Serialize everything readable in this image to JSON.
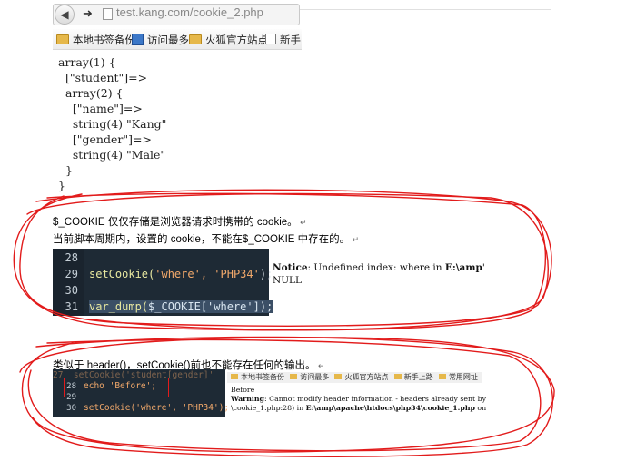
{
  "browser": {
    "url": "test.kang.com/cookie_2.php",
    "back_icon": "arrow-left-icon",
    "forward_icon": "arrow-right-icon",
    "bookmarks": [
      "本地书签备份",
      "访问最多",
      "火狐官方站点",
      "新手"
    ]
  },
  "dump_output": "array(1) {\n  [\"student\"]=>\n  array(2) {\n    [\"name\"]=>\n    string(4) \"Kang\"\n    [\"gender\"]=>\n    string(4) \"Male\"\n  }\n}",
  "section1": {
    "line1": "$_COOKIE 仅仅存储是浏览器请求时携带的 cookie。",
    "line2": "当前脚本周期内，设置的 cookie，不能在$_COOKIE 中存在的。",
    "editor": {
      "lines": [
        {
          "num": "28",
          "code": ""
        },
        {
          "num": "29",
          "fn": "setCookie(",
          "args": "'where', 'PHP34'",
          "end": ");"
        },
        {
          "num": "30",
          "code": ""
        },
        {
          "num": "31",
          "fn": "var_dump(",
          "args": "$_COOKIE['where']",
          "end": ");"
        }
      ]
    },
    "notice": {
      "label": "Notice",
      "message": ": Undefined index: where in ",
      "path": "E:\\amp",
      "tail": "'",
      "null_text": "NULL"
    }
  },
  "section2": {
    "line_prefix": "类似于 header()，",
    "line_underlined": "setCookie()",
    "line_suffix": "前也不能存在任何的输出。",
    "editor": {
      "faded_line": "27  setCookie('student[gender]'",
      "lines": [
        {
          "num": "28",
          "code": "echo 'Before';"
        },
        {
          "num": "29",
          "code": ""
        },
        {
          "num": "30",
          "code": "setCookie('where', 'PHP34');"
        }
      ]
    },
    "mini_bookmarks": [
      "本地书签备份",
      "访问最多",
      "火狐官方站点",
      "新手上路",
      "常用网址"
    ],
    "output": {
      "before": "Before",
      "warning_label": "Warning",
      "warning_text": ": Cannot modify header information - headers already sent by",
      "warning_text2": "\\cookie_1.php:28) in ",
      "warning_path": "E:\\amp\\apache\\htdocs\\php34\\cookie_1.php",
      "warning_on": " on"
    }
  },
  "colors": {
    "annotation_red": "#e21b1b",
    "editor_bg": "#1e2a35",
    "string_color": "#f2a96b"
  }
}
